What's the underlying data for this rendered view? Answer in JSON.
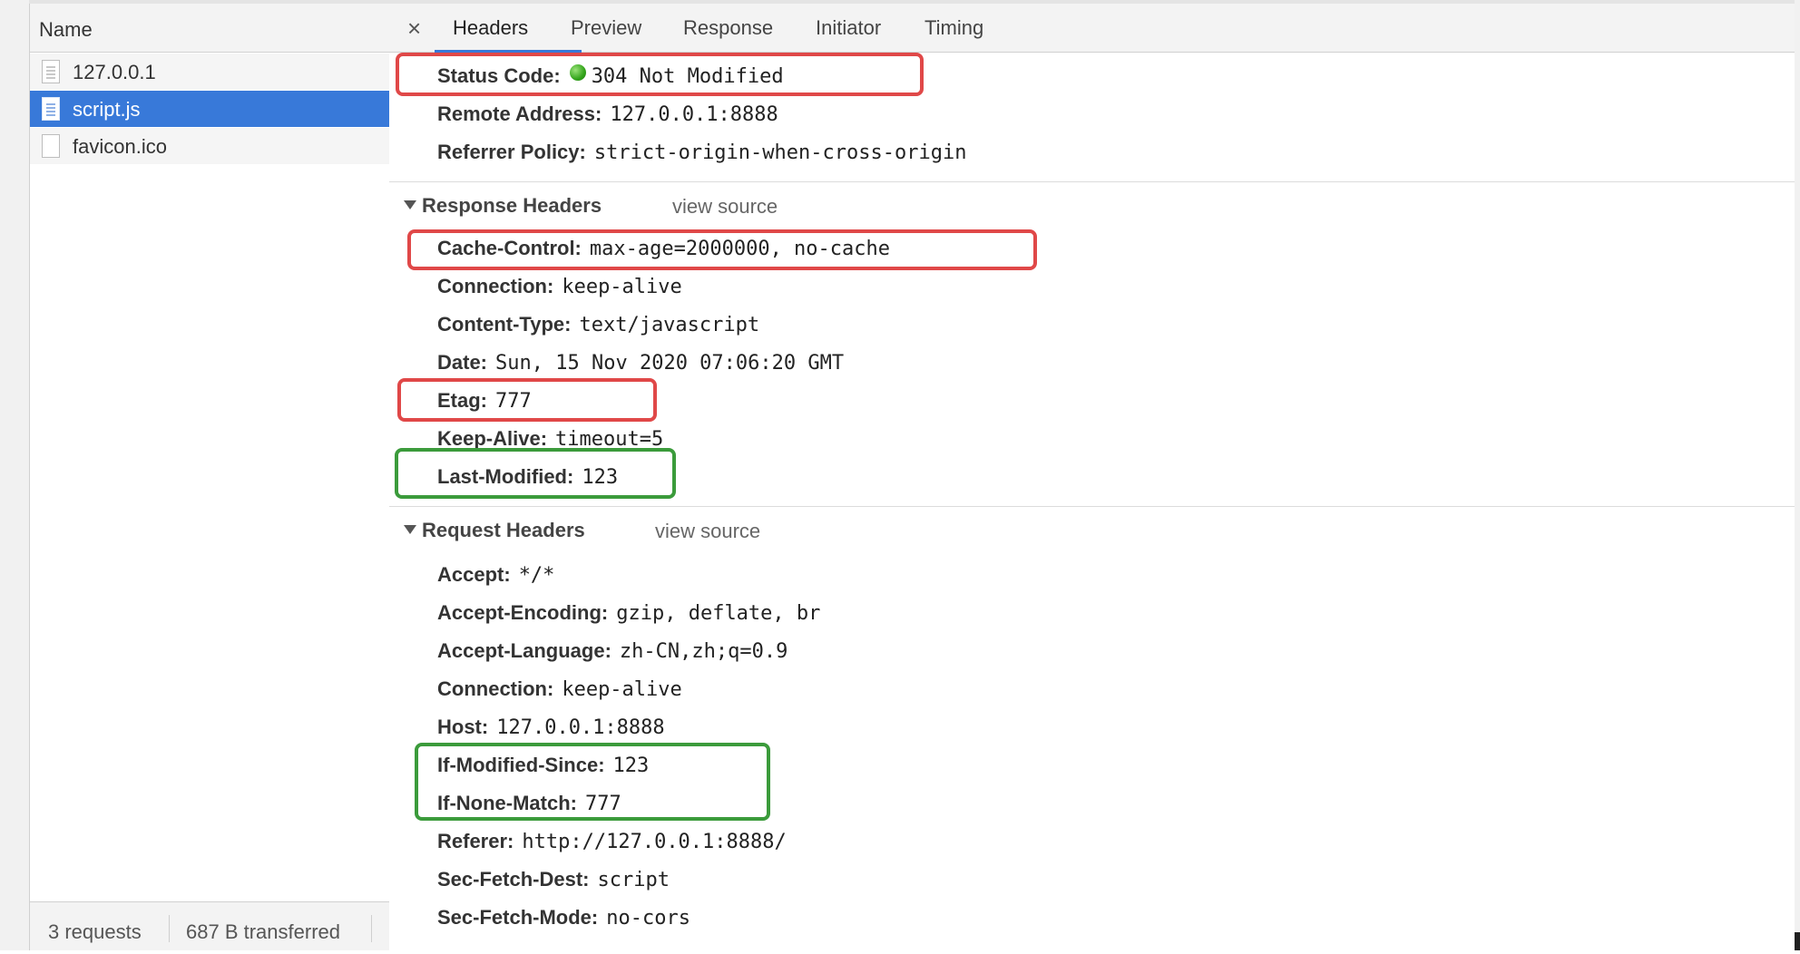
{
  "request_list": {
    "column_header": "Name",
    "items": [
      {
        "name": "127.0.0.1"
      },
      {
        "name": "script.js"
      },
      {
        "name": "favicon.ico"
      }
    ],
    "footer": {
      "requests": "3 requests",
      "transferred": "687 B transferred"
    }
  },
  "tabs": {
    "close_icon": "×",
    "items": [
      "Headers",
      "Preview",
      "Response",
      "Initiator",
      "Timing"
    ]
  },
  "general": {
    "status_code": {
      "name": "Status Code:",
      "value": "304 Not Modified"
    },
    "remote_address": {
      "name": "Remote Address:",
      "value": "127.0.0.1:8888"
    },
    "referrer_policy": {
      "name": "Referrer Policy:",
      "value": "strict-origin-when-cross-origin"
    }
  },
  "response_headers": {
    "title": "Response Headers",
    "view_source": "view source",
    "items": [
      {
        "name": "Cache-Control:",
        "value": "max-age=2000000, no-cache"
      },
      {
        "name": "Connection:",
        "value": "keep-alive"
      },
      {
        "name": "Content-Type:",
        "value": "text/javascript"
      },
      {
        "name": "Date:",
        "value": "Sun, 15 Nov 2020 07:06:20 GMT"
      },
      {
        "name": "Etag:",
        "value": "777"
      },
      {
        "name": "Keep-Alive:",
        "value": "timeout=5"
      },
      {
        "name": "Last-Modified:",
        "value": "123"
      }
    ]
  },
  "request_headers": {
    "title": "Request Headers",
    "view_source": "view source",
    "items": [
      {
        "name": "Accept:",
        "value": "*/*"
      },
      {
        "name": "Accept-Encoding:",
        "value": "gzip, deflate, br"
      },
      {
        "name": "Accept-Language:",
        "value": "zh-CN,zh;q=0.9"
      },
      {
        "name": "Connection:",
        "value": "keep-alive"
      },
      {
        "name": "Host:",
        "value": "127.0.0.1:8888"
      },
      {
        "name": "If-Modified-Since:",
        "value": "123"
      },
      {
        "name": "If-None-Match:",
        "value": "777"
      },
      {
        "name": "Referer:",
        "value": "http://127.0.0.1:8888/"
      },
      {
        "name": "Sec-Fetch-Dest:",
        "value": "script"
      },
      {
        "name": "Sec-Fetch-Mode:",
        "value": "no-cors"
      }
    ]
  },
  "colors": {
    "selection": "#3879d9",
    "highlight_red": "#e04848",
    "highlight_green": "#3b9b3b",
    "status_ok": "#33a41b"
  }
}
